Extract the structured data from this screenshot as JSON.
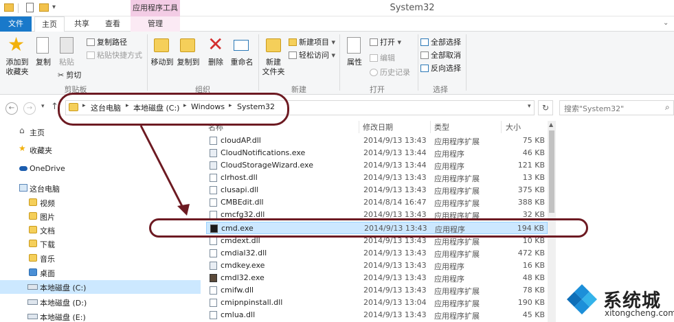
{
  "titlebar": {
    "context_tab": "应用程序工具",
    "window_title": "System32"
  },
  "tabs": [
    {
      "label": "文件"
    },
    {
      "label": "主页"
    },
    {
      "label": "共享"
    },
    {
      "label": "查看"
    },
    {
      "label": "管理"
    }
  ],
  "ribbon": {
    "pin_label_1": "添加到",
    "pin_label_2": "收藏夹",
    "copy": "复制",
    "paste": "粘贴",
    "copy_path": "复制路径",
    "paste_shortcut": "粘贴快捷方式",
    "cut": "剪切",
    "clipboard_group": "剪贴板",
    "move_to": "移动到",
    "copy_to": "复制到",
    "delete": "删除",
    "rename": "重命名",
    "organize_group": "组织",
    "new_folder_1": "新建",
    "new_folder_2": "文件夹",
    "new_item": "新建项目",
    "easy_access": "轻松访问",
    "new_group": "新建",
    "properties": "属性",
    "open": "打开",
    "edit": "编辑",
    "history": "历史记录",
    "open_group": "打开",
    "select_all": "全部选择",
    "select_none": "全部取消",
    "invert_selection": "反向选择",
    "select_group": "选择"
  },
  "address": {
    "crumbs": [
      "这台电脑",
      "本地磁盘 (C:)",
      "Windows",
      "System32"
    ],
    "search_placeholder": "搜索\"System32\""
  },
  "nav": [
    {
      "label": "主页",
      "icon": "home-icon"
    },
    {
      "label": "收藏夹",
      "icon": "star-icon"
    },
    {
      "label": "OneDrive",
      "icon": "cloud-icon"
    },
    {
      "label": "这台电脑",
      "icon": "computer-icon"
    },
    {
      "label": "视频",
      "icon": "video-folder-icon"
    },
    {
      "label": "图片",
      "icon": "pictures-folder-icon"
    },
    {
      "label": "文档",
      "icon": "documents-folder-icon"
    },
    {
      "label": "下载",
      "icon": "downloads-folder-icon"
    },
    {
      "label": "音乐",
      "icon": "music-folder-icon"
    },
    {
      "label": "桌面",
      "icon": "desktop-folder-icon"
    },
    {
      "label": "本地磁盘 (C:)",
      "icon": "drive-icon"
    },
    {
      "label": "本地磁盘 (D:)",
      "icon": "drive-icon"
    },
    {
      "label": "本地磁盘 (E:)",
      "icon": "drive-icon"
    }
  ],
  "columns": {
    "name": "名称",
    "date": "修改日期",
    "type": "类型",
    "size": "大小"
  },
  "files": [
    {
      "name": "cloudAP.dll",
      "date": "2014/9/13 13:43",
      "type": "应用程序扩展",
      "size": "75 KB"
    },
    {
      "name": "CloudNotifications.exe",
      "date": "2014/9/13 13:44",
      "type": "应用程序",
      "size": "46 KB"
    },
    {
      "name": "CloudStorageWizard.exe",
      "date": "2014/9/13 13:44",
      "type": "应用程序",
      "size": "121 KB"
    },
    {
      "name": "clrhost.dll",
      "date": "2014/9/13 13:43",
      "type": "应用程序扩展",
      "size": "13 KB"
    },
    {
      "name": "clusapi.dll",
      "date": "2014/9/13 13:43",
      "type": "应用程序扩展",
      "size": "375 KB"
    },
    {
      "name": "CMBEdit.dll",
      "date": "2014/8/14 16:47",
      "type": "应用程序扩展",
      "size": "388 KB"
    },
    {
      "name": "cmcfg32.dll",
      "date": "2014/9/13 13:43",
      "type": "应用程序扩展",
      "size": "32 KB"
    },
    {
      "name": "cmd.exe",
      "date": "2014/9/13 13:43",
      "type": "应用程序",
      "size": "194 KB"
    },
    {
      "name": "cmdext.dll",
      "date": "2014/9/13 13:43",
      "type": "应用程序扩展",
      "size": "10 KB"
    },
    {
      "name": "cmdial32.dll",
      "date": "2014/9/13 13:43",
      "type": "应用程序扩展",
      "size": "472 KB"
    },
    {
      "name": "cmdkey.exe",
      "date": "2014/9/13 13:43",
      "type": "应用程序",
      "size": "16 KB"
    },
    {
      "name": "cmdl32.exe",
      "date": "2014/9/13 13:43",
      "type": "应用程序",
      "size": "48 KB"
    },
    {
      "name": "cmifw.dll",
      "date": "2014/9/13 13:43",
      "type": "应用程序扩展",
      "size": "78 KB"
    },
    {
      "name": "cmipnpinstall.dll",
      "date": "2014/9/13 13:04",
      "type": "应用程序扩展",
      "size": "190 KB"
    },
    {
      "name": "cmlua.dll",
      "date": "2014/9/13 13:43",
      "type": "应用程序扩展",
      "size": "45 KB"
    }
  ],
  "watermark": {
    "name": "系统城",
    "url": "xitongcheng.com"
  },
  "colors": {
    "file_tab": "#1979ca",
    "context_tab": "#f3cce5",
    "selection": "#cce8ff",
    "annotation": "#6d1a22"
  }
}
